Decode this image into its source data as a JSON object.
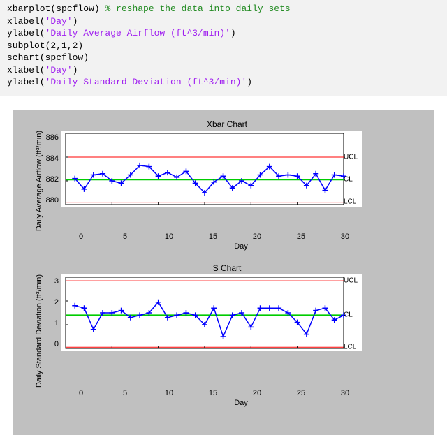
{
  "code": {
    "l1a": "xbarplot(spcflow) ",
    "l1b": "% reshape the data into daily sets",
    "l2a": "xlabel(",
    "l2s": "'Day'",
    "l2b": ")",
    "l3a": "ylabel(",
    "l3s": "'Daily Average Airflow (ft^3/min)'",
    "l3b": ")",
    "l4": "subplot(2,1,2)",
    "l5": "schart(spcflow)",
    "l6a": "xlabel(",
    "l6s": "'Day'",
    "l6b": ")",
    "l7a": "ylabel(",
    "l7s": "'Daily Standard Deviation (ft^3/min)'",
    "l7b": ")"
  },
  "chart_data": [
    {
      "type": "line",
      "title": "Xbar Chart",
      "xlabel": "Day",
      "ylabel": "Daily Average Airflow (ft³/min)",
      "ylim": [
        880,
        886
      ],
      "yticks": [
        886,
        884,
        882,
        880
      ],
      "xlim": [
        0,
        30
      ],
      "xticks": [
        0,
        5,
        10,
        15,
        20,
        25,
        30
      ],
      "limits": {
        "UCL": 884.0,
        "CL": 882.1,
        "LCL": 880.2
      },
      "limit_labels": {
        "UCL": "UCL",
        "CL": "CL",
        "LCL": "LCL"
      },
      "series": [
        {
          "name": "xbar",
          "x": [
            1,
            2,
            3,
            4,
            5,
            6,
            7,
            8,
            9,
            10,
            11,
            12,
            13,
            14,
            15,
            16,
            17,
            18,
            19,
            20,
            21,
            22,
            23,
            24,
            25,
            26,
            27,
            28,
            29,
            30
          ],
          "values": [
            882.2,
            881.3,
            882.5,
            882.6,
            882.0,
            881.8,
            882.5,
            883.3,
            883.2,
            882.4,
            882.7,
            882.3,
            882.8,
            881.8,
            881.0,
            881.9,
            882.4,
            881.4,
            882.0,
            881.6,
            882.5,
            883.2,
            882.4,
            882.5,
            882.4,
            881.6,
            882.6,
            881.2,
            882.5,
            882.4
          ]
        }
      ]
    },
    {
      "type": "line",
      "title": "S Chart",
      "xlabel": "Day",
      "ylabel": "Daily Standard Deviation (ft³/min)",
      "ylim": [
        0,
        3
      ],
      "yticks": [
        3,
        2,
        1,
        0
      ],
      "xlim": [
        0,
        30
      ],
      "xticks": [
        0,
        5,
        10,
        15,
        20,
        25,
        30
      ],
      "limits": {
        "UCL": 2.85,
        "CL": 1.4,
        "LCL": 0.05
      },
      "limit_labels": {
        "UCL": "UCL",
        "CL": "CL",
        "LCL": "LCL"
      },
      "series": [
        {
          "name": "s",
          "x": [
            1,
            2,
            3,
            4,
            5,
            6,
            7,
            8,
            9,
            10,
            11,
            12,
            13,
            14,
            15,
            16,
            17,
            18,
            19,
            20,
            21,
            22,
            23,
            24,
            25,
            26,
            27,
            28,
            29,
            30
          ],
          "values": [
            1.8,
            1.7,
            0.8,
            1.5,
            1.5,
            1.6,
            1.3,
            1.4,
            1.5,
            1.95,
            1.3,
            1.4,
            1.5,
            1.4,
            1.0,
            1.7,
            0.5,
            1.4,
            1.5,
            0.9,
            1.7,
            1.7,
            1.7,
            1.5,
            1.1,
            0.6,
            1.6,
            1.7,
            1.2,
            1.4
          ]
        }
      ]
    }
  ]
}
